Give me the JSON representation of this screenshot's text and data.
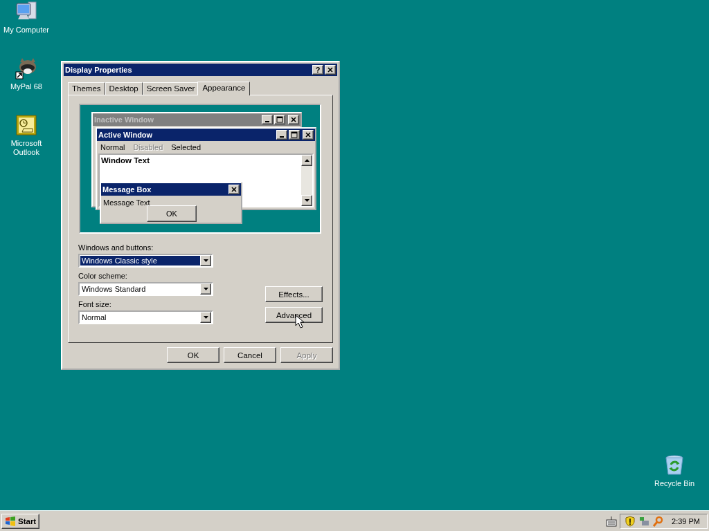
{
  "desktop_icons": [
    {
      "kind": "computer",
      "label": "My Computer"
    },
    {
      "kind": "raccoon",
      "label": "MyPal 68"
    },
    {
      "kind": "outlook",
      "label": "Microsoft Outlook"
    }
  ],
  "recycle_bin": {
    "label": "Recycle Bin"
  },
  "dialog": {
    "title": "Display Properties",
    "help": "?",
    "tabs": [
      {
        "label": "Themes",
        "selected": false
      },
      {
        "label": "Desktop",
        "selected": false
      },
      {
        "label": "Screen Saver",
        "selected": false
      },
      {
        "label": "Appearance",
        "selected": true
      }
    ],
    "preview": {
      "inactive_title": "Inactive Window",
      "active_title": "Active Window",
      "menu": [
        {
          "label": "Normal",
          "disabled": false
        },
        {
          "label": "Disabled",
          "disabled": true
        },
        {
          "label": "Selected",
          "disabled": false
        }
      ],
      "window_text": "Window Text",
      "message_title": "Message Box",
      "message_text": "Message Text",
      "ok": "OK"
    },
    "fields": [
      {
        "label": "Windows and buttons:",
        "value": "Windows Classic style",
        "focused": true
      },
      {
        "label": "Color scheme:",
        "value": "Windows Standard",
        "focused": false
      },
      {
        "label": "Font size:",
        "value": "Normal",
        "focused": false
      }
    ],
    "side_buttons": [
      "Effects...",
      "Advanced"
    ],
    "buttons": [
      {
        "label": "OK",
        "disabled": false
      },
      {
        "label": "Cancel",
        "disabled": false
      },
      {
        "label": "Apply",
        "disabled": true
      }
    ]
  },
  "taskbar": {
    "start": "Start",
    "clock": "2:39 PM"
  }
}
